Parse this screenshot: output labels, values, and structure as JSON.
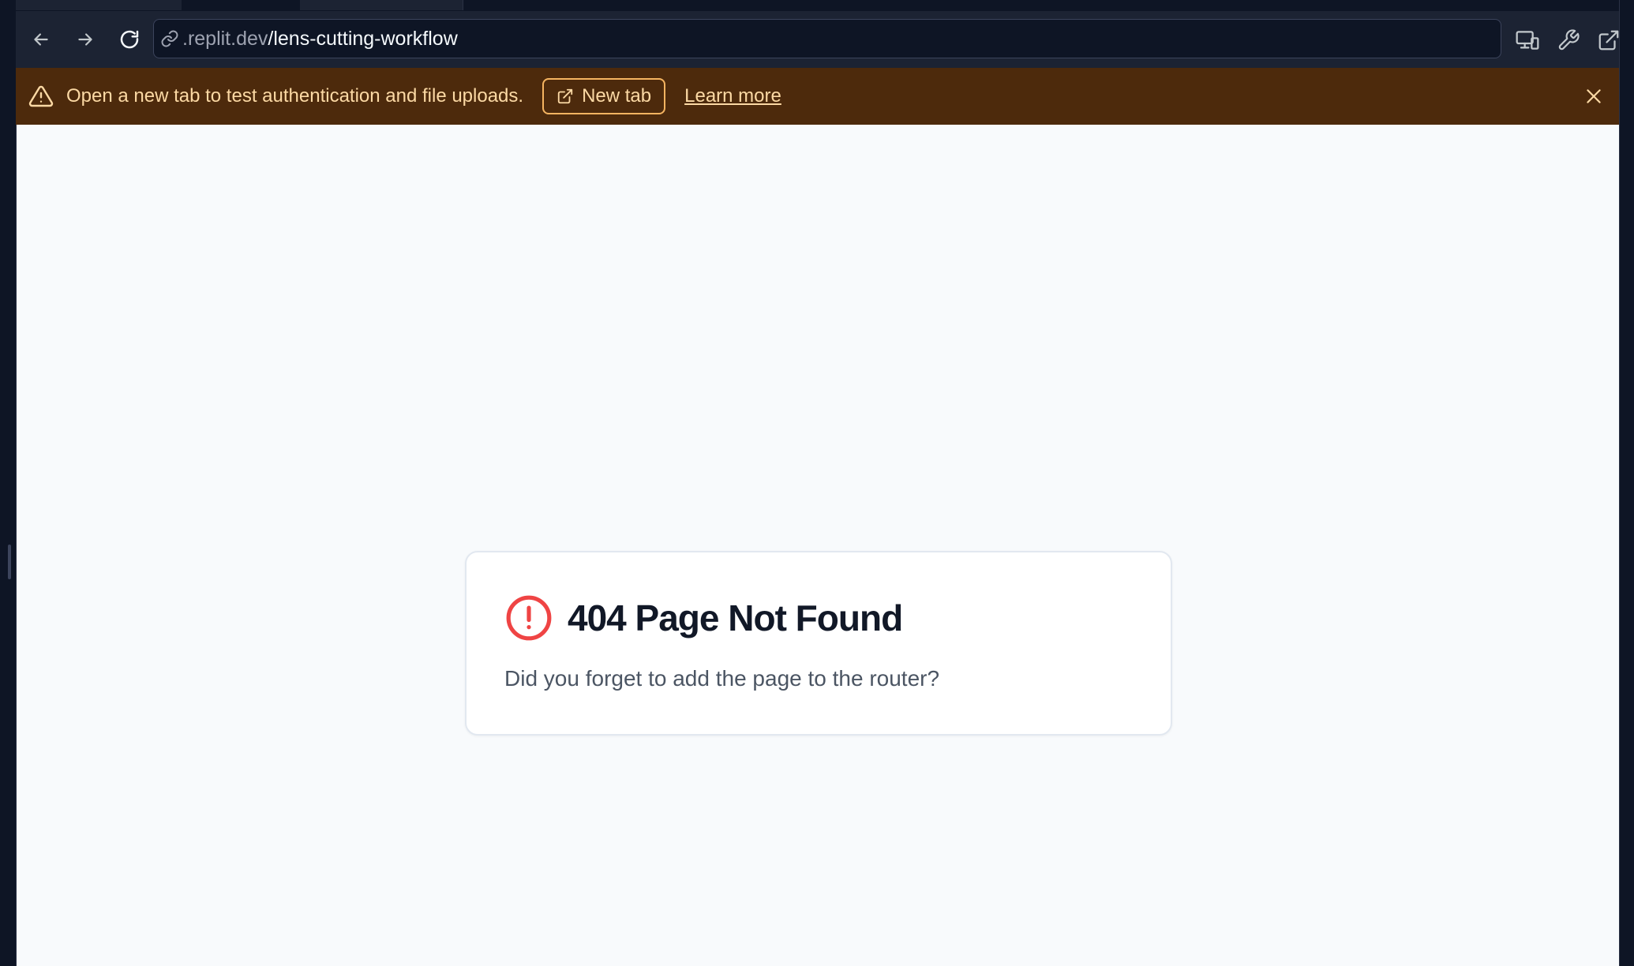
{
  "browser": {
    "url_host": ".replit.dev",
    "url_path": "/lens-cutting-workflow"
  },
  "banner": {
    "message": "Open a new tab to test authentication and file uploads.",
    "new_tab_label": "New tab",
    "learn_more_label": "Learn more",
    "background_color": "#4d2a0c",
    "text_color": "#fcd9a4"
  },
  "page": {
    "title": "404 Page Not Found",
    "message": "Did you forget to add the page to the router?",
    "error_icon_color": "#ef4444"
  },
  "icons": {
    "back": "arrow-left-icon",
    "forward": "arrow-right-icon",
    "reload": "reload-icon",
    "link": "link-icon",
    "devices": "devices-icon",
    "devtools": "wrench-icon",
    "open_external": "external-link-icon",
    "warning": "warning-triangle-icon",
    "close": "close-icon",
    "error": "alert-circle-icon"
  }
}
